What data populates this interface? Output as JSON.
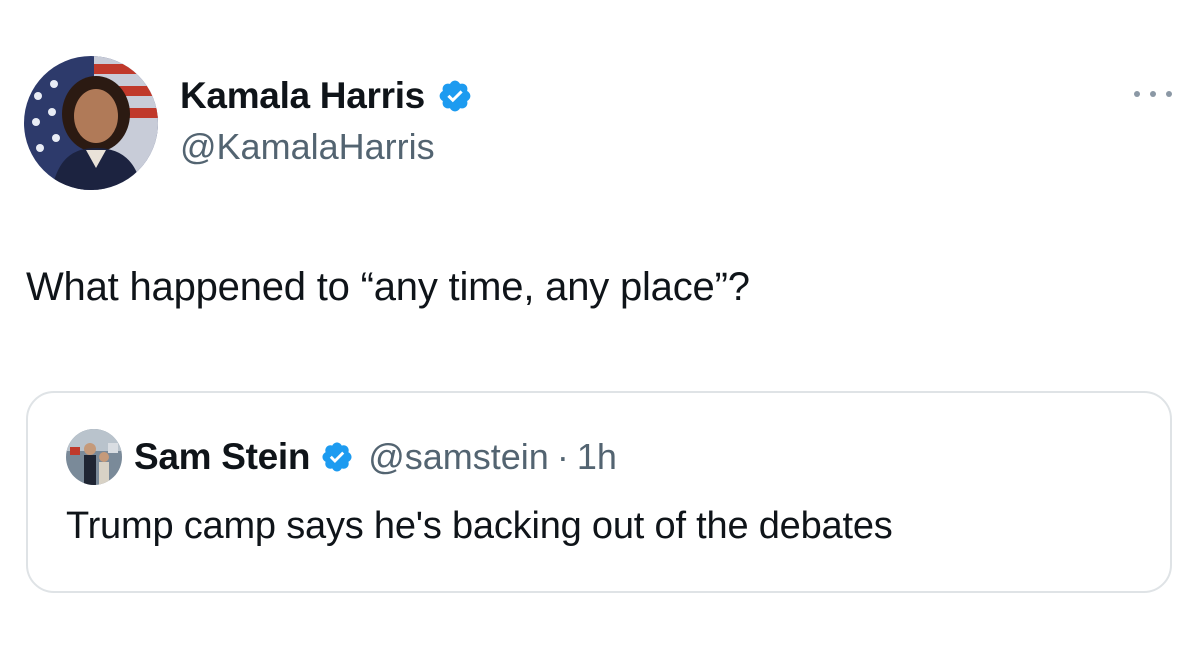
{
  "tweet": {
    "author": {
      "display_name": "Kamala Harris",
      "handle": "@KamalaHarris",
      "verified": true,
      "avatar_icon": "portrait-avatar-flag-background"
    },
    "more_icon": "more-horizontal-icon",
    "text": "What happened to “any time, any place”?",
    "quote": {
      "author": {
        "display_name": "Sam Stein",
        "handle": "@samstein",
        "verified": true,
        "avatar_icon": "portrait-avatar-small"
      },
      "separator": "·",
      "time": "1h",
      "text": "Trump camp says he's backing out of the debates"
    }
  },
  "colors": {
    "text_primary": "#0f1419",
    "text_secondary": "#536471",
    "verified_blue": "#1d9bf0",
    "border": "#dfe3e6"
  }
}
